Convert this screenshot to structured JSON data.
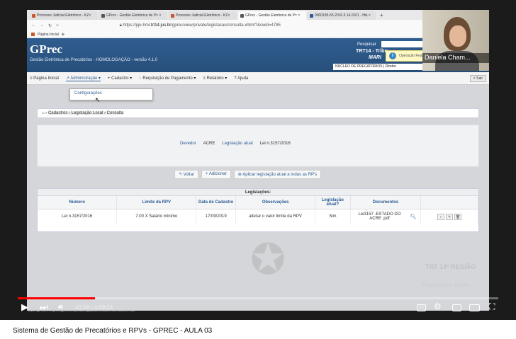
{
  "browser": {
    "tabs": [
      {
        "label": "Processo Judicial Eletrônico - KZ×",
        "active": false
      },
      {
        "label": "GPrec - Gestão Eletrônica de P× ×",
        "active": false
      },
      {
        "label": "Processo Judicial Eletrônico - KZ×",
        "active": false
      },
      {
        "label": "GPrec - Gestão Eletrônica de P× ×",
        "active": true
      },
      {
        "label": "0000185-55.2016.5.14.0101 - His ×",
        "active": false
      }
    ],
    "new_tab": "+",
    "url_prefix": "https://pje-hml.",
    "url_host": "trt14.jus.br",
    "url_path": "/gprec/view/private/legislacao/consulta.xhtml?&cwid=4785",
    "bookmark": "Página Inicial"
  },
  "app": {
    "title": "GPrec",
    "subtitle": "Gestão Eletrônica de Precatórios - HOMOLOGAÇÃO - versão 4.1.0",
    "search_label": "Pesquisar",
    "trt": "TRT14 - Tribu",
    "user_name": "MARI",
    "unit": "NÚCLEO DE PRECATÓRIOS | Diretor",
    "notice": "Operação Realizada com Sucesso"
  },
  "nav": {
    "items": [
      {
        "label": "≡ Página Inicial"
      },
      {
        "label": "↗ Administração ▾"
      },
      {
        "label": "+ Cadastro ▾"
      },
      {
        "label": "◌ Requisição de Pagamento ▾"
      },
      {
        "label": "≡ Relatório ▾"
      },
      {
        "label": "? Ajuda"
      }
    ],
    "logout": "× Sair",
    "dropdown_item": "Configurações"
  },
  "breadcrumb": {
    "home": "⌂ ›",
    "trail": "Cadastros › Legislação Local › Consulta"
  },
  "info": {
    "devedor_label": "Devedor",
    "devedor_value": "ACRE",
    "leg_label": "Legislação atual",
    "leg_value": "Lei n.3157/2016"
  },
  "buttons": {
    "voltar": "↰ Voltar",
    "adicionar": "+ Adicionar",
    "aplicar": "⊕ Aplicar legislação atual a todas as RP's"
  },
  "table": {
    "caption": "Legislações:",
    "headers": [
      "Número",
      "Limite da RPV",
      "Data de Cadastro",
      "Observações",
      "Legislação atual?",
      "Documentos",
      ""
    ],
    "rows": [
      {
        "numero": "Lei n.3157/2016",
        "limite": "7.00 X Salário mínimo",
        "data": "17/09/2019",
        "obs": "alterar o valor limite da RPV",
        "atual": "Sim",
        "doc": "Lei3157 -ESTADO DO ACRE .pdf",
        "actions": [
          "✓",
          "✎",
          "🗑"
        ]
      }
    ]
  },
  "overlay": {
    "webcam_name": "Daniela Cham...",
    "brand": "TRT 14ª REGIÃO",
    "brand_sub": "Powered by Zoom",
    "status_url": "https://pje-hml.trt14.jus.br/gprec/view/private/legislacao/consulta.xhtml?&cwid=4785#"
  },
  "player": {
    "time": "40:09 / 4:09:24",
    "progress_fraction": 0.161,
    "progress_color": "#ff0000"
  },
  "video_title": "Sistema de Gestão de Precatórios e RPVs - GPREC - AULA 03"
}
